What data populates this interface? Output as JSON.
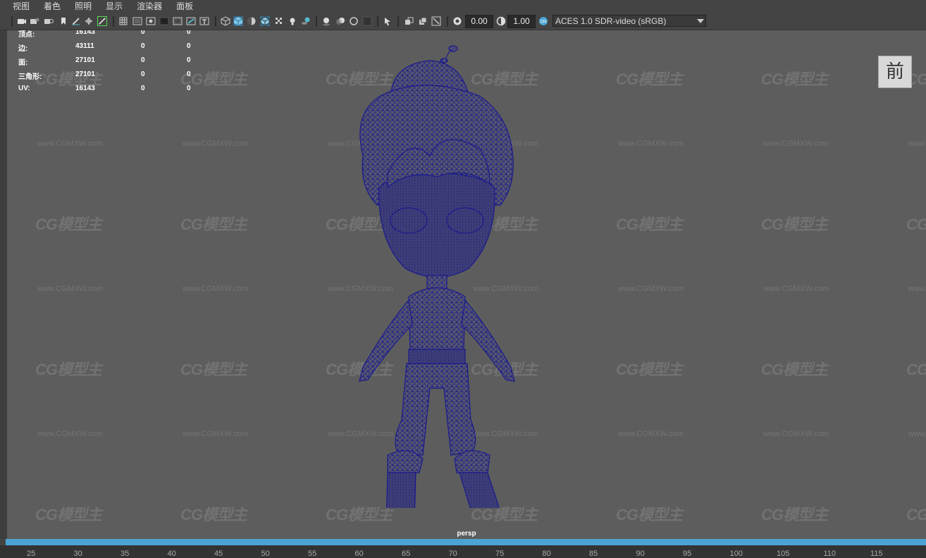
{
  "menu": [
    "视图",
    "着色",
    "照明",
    "显示",
    "渲染器",
    "面板"
  ],
  "toolbar": {
    "exposure": "0.00",
    "gamma": "1.00",
    "color_space": "ACES 1.0 SDR-video (sRGB)",
    "icons": [
      "camera-icon",
      "camera-lock-icon",
      "film-icon",
      "bookmark-icon",
      "grease-pencil-icon",
      "transform-icon",
      "paint-icon",
      "grid-icon",
      "film-gate-icon",
      "resolution-gate-icon",
      "gate-mask-icon",
      "field-chart-icon",
      "safe-action-icon",
      "safe-title-icon",
      "wireframe-icon",
      "smooth-shade-icon",
      "shade-all-icon",
      "wireframe-on-shaded-icon",
      "textured-icon",
      "lights-icon",
      "shadows-icon",
      "ambient-occlusion-icon",
      "motion-blur-icon",
      "antialias-icon",
      "depth-of-field-icon",
      "isolate-select-icon",
      "xray-icon",
      "xray-joints-icon",
      "xray-active-icon",
      "backface-icon",
      "exposure-icon",
      "gamma-icon",
      "color-management-icon"
    ]
  },
  "hud": {
    "rows": [
      {
        "label": "顶点:",
        "v1": "16143",
        "v2": "0",
        "v3": "0"
      },
      {
        "label": "边:",
        "v1": "43111",
        "v2": "0",
        "v3": "0"
      },
      {
        "label": "面:",
        "v1": "27101",
        "v2": "0",
        "v3": "0"
      },
      {
        "label": "三角形:",
        "v1": "27101",
        "v2": "0",
        "v3": "0"
      },
      {
        "label": "UV:",
        "v1": "16143",
        "v2": "0",
        "v3": "0"
      }
    ]
  },
  "viewcube": {
    "label": "前"
  },
  "camera": {
    "name": "persp"
  },
  "watermark": {
    "logo": "CG模型主",
    "url": "www.CGMXW.com"
  },
  "ruler": {
    "ticks": [
      "25",
      "30",
      "35",
      "40",
      "45",
      "50",
      "55",
      "60",
      "65",
      "70",
      "75",
      "80",
      "85",
      "90",
      "95",
      "100",
      "105",
      "110",
      "115"
    ]
  },
  "colors": {
    "accent": "#4aa5d4",
    "wireframe": "#1a1a8c",
    "viewport": "#5d5d5d"
  }
}
